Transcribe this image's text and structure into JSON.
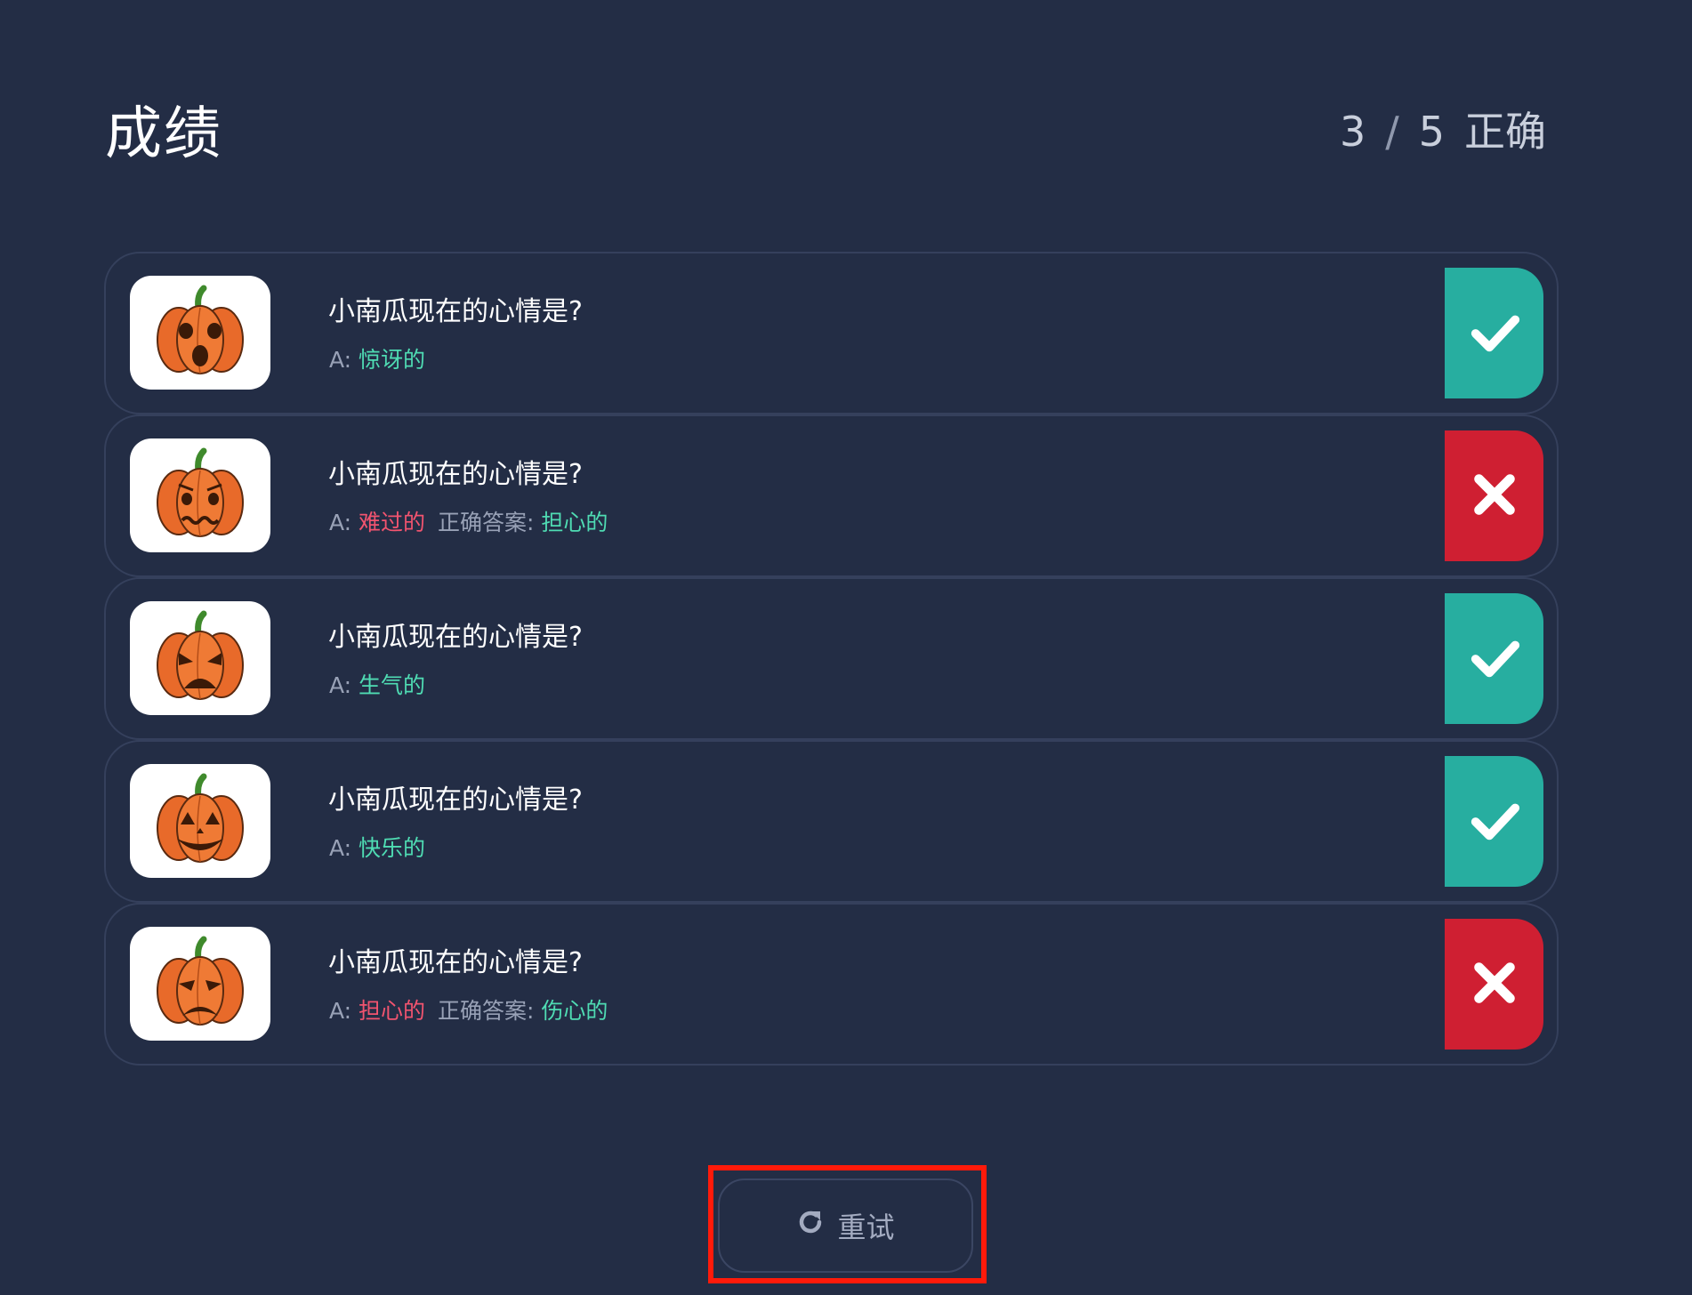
{
  "title": "成绩",
  "score": {
    "correct": "3",
    "separator": "/",
    "total": "5",
    "label": "正确"
  },
  "results": [
    {
      "question": "小南瓜现在的心情是?",
      "answer_prefix": "A:",
      "answer": "惊讶的",
      "status": "correct",
      "face": "surprised"
    },
    {
      "question": "小南瓜现在的心情是?",
      "answer_prefix": "A:",
      "answer": "难过的",
      "correct_label": "正确答案:",
      "correct_answer": "担心的",
      "status": "wrong",
      "face": "worried"
    },
    {
      "question": "小南瓜现在的心情是?",
      "answer_prefix": "A:",
      "answer": "生气的",
      "status": "correct",
      "face": "angry"
    },
    {
      "question": "小南瓜现在的心情是?",
      "answer_prefix": "A:",
      "answer": "快乐的",
      "status": "correct",
      "face": "happy"
    },
    {
      "question": "小南瓜现在的心情是?",
      "answer_prefix": "A:",
      "answer": "担心的",
      "correct_label": "正确答案:",
      "correct_answer": "伤心的",
      "status": "wrong",
      "face": "sad"
    }
  ],
  "retry_label": "重试",
  "colors": {
    "background": "#232d45",
    "correct": "#27aea0",
    "wrong": "#cf1f32",
    "answer_correct_text": "#4fdcb3",
    "answer_wrong_text": "#f2546f",
    "highlight": "#ff1a0a"
  },
  "icons": {
    "correct": "check-icon",
    "wrong": "close-icon",
    "retry": "refresh-icon",
    "thumbnail": "pumpkin-icon"
  }
}
